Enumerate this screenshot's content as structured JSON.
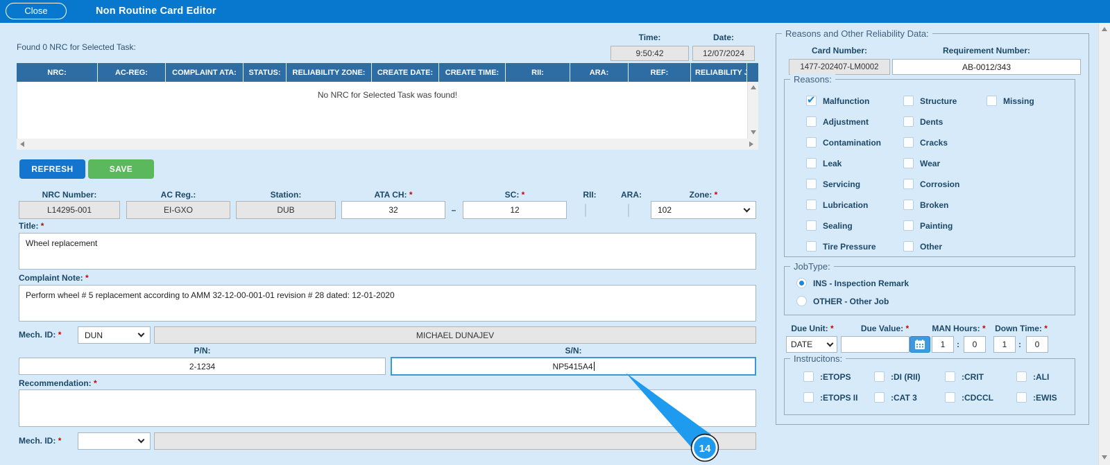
{
  "titlebar": {
    "close": "Close",
    "title": "Non Routine Card Editor"
  },
  "ui": {
    "asterisk": "*",
    "dash": "–",
    "colon": ":"
  },
  "nrc_list": {
    "found_text": "Found 0 NRC for Selected Task:",
    "time": {
      "label": "Time:",
      "value": "9:50:42"
    },
    "date": {
      "label": "Date:",
      "value": "12/07/2024"
    },
    "columns": [
      "NRC:",
      "AC-REG:",
      "COMPLAINT ATA:",
      "STATUS:",
      "RELIABILITY ZONE:",
      "CREATE DATE:",
      "CREATE TIME:",
      "RII:",
      "ARA:",
      "REF:",
      "RELIABILITY JI"
    ],
    "empty_message": "No NRC for Selected Task was found!"
  },
  "actions": {
    "refresh": "REFRESH",
    "save": "SAVE"
  },
  "form": {
    "nrc_number": {
      "label": "NRC Number:",
      "value": "L14295-001"
    },
    "ac_reg": {
      "label": "AC Reg.:",
      "value": "EI-GXO"
    },
    "station": {
      "label": "Station:",
      "value": "DUB"
    },
    "ata_ch": {
      "label": "ATA CH:",
      "value": "32"
    },
    "sc": {
      "label": "SC:",
      "value": "12"
    },
    "rii": {
      "label": "RII:",
      "checked": false
    },
    "ara": {
      "label": "ARA:",
      "checked": false
    },
    "zone": {
      "label": "Zone:",
      "value": "102"
    },
    "title": {
      "label": "Title:",
      "value": "Wheel replacement"
    },
    "complaint_note": {
      "label": "Complaint Note:",
      "value": "Perform wheel # 5 replacement according to AMM 32-12-00-001-01 revision # 28 dated: 12-01-2020"
    },
    "mech_id_top": {
      "label": "Mech. ID:",
      "value": "DUN",
      "full_name": "MICHAEL DUNAJEV"
    },
    "pn": {
      "label": "P/N:",
      "value": "2-1234"
    },
    "sn": {
      "label": "S/N:",
      "value": "NP5415A4"
    },
    "recommendation": {
      "label": "Recommendation:",
      "value": ""
    },
    "mech_id_bottom": {
      "label": "Mech. ID:",
      "value": "",
      "full_name": ""
    }
  },
  "reliability": {
    "legend": "Reasons and Other Reliability Data:",
    "card_number": {
      "label": "Card Number:",
      "value": "1477-202407-LM0002"
    },
    "requirement_number": {
      "label": "Requirement Number:",
      "value": "AB-0012/343"
    },
    "reasons": {
      "legend": "Reasons:",
      "items": [
        {
          "label": "Malfunction",
          "checked": true
        },
        {
          "label": "Structure",
          "checked": false
        },
        {
          "label": "Missing",
          "checked": false
        },
        {
          "label": "Adjustment",
          "checked": false
        },
        {
          "label": "Dents",
          "checked": false
        },
        {
          "label": "Contamination",
          "checked": false
        },
        {
          "label": "Cracks",
          "checked": false
        },
        {
          "label": "Leak",
          "checked": false
        },
        {
          "label": "Wear",
          "checked": false
        },
        {
          "label": "Servicing",
          "checked": false
        },
        {
          "label": "Corrosion",
          "checked": false
        },
        {
          "label": "Lubrication",
          "checked": false
        },
        {
          "label": "Broken",
          "checked": false
        },
        {
          "label": "Sealing",
          "checked": false
        },
        {
          "label": "Painting",
          "checked": false
        },
        {
          "label": "Tire Pressure",
          "checked": false
        },
        {
          "label": "Other",
          "checked": false
        }
      ]
    },
    "job_type": {
      "legend": "JobType:",
      "options": [
        {
          "label": "INS - Inspection Remark",
          "selected": true
        },
        {
          "label": "OTHER - Other Job",
          "selected": false
        }
      ]
    },
    "due": {
      "due_unit": {
        "label": "Due Unit:",
        "value": "DATE"
      },
      "due_value": {
        "label": "Due Value:",
        "value": ""
      },
      "man_hours": {
        "label": "MAN Hours:",
        "h": "1",
        "m": "0"
      },
      "down_time": {
        "label": "Down Time:",
        "h": "1",
        "m": "0"
      }
    },
    "instructions": {
      "legend": "Instrucitons:",
      "items": [
        ":ETOPS",
        ":DI (RII)",
        ":CRIT",
        ":ALI",
        ":ETOPS II",
        ":CAT 3",
        ":CDCCL",
        ":EWIS"
      ]
    }
  },
  "annotation": {
    "step_badge": "14"
  }
}
